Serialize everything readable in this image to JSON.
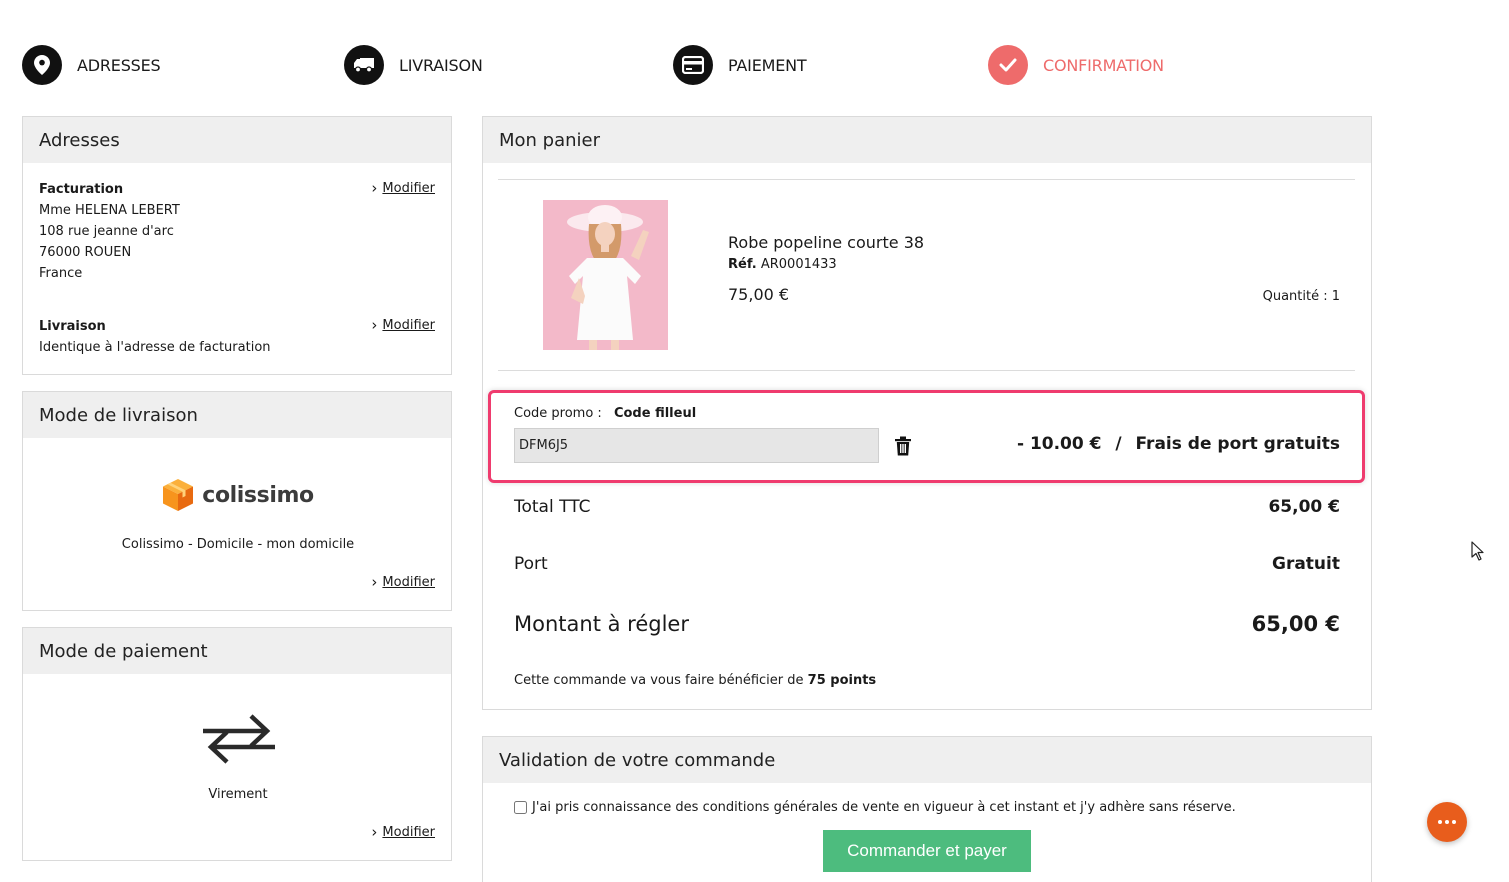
{
  "colors": {
    "accent": "#ee6b6b",
    "promo_border": "#ef3b6e",
    "order_button": "#4dbc7e",
    "chat_button": "#e85d1c"
  },
  "steps": [
    {
      "label": "ADRESSES",
      "icon": "map-pin-icon"
    },
    {
      "label": "LIVRAISON",
      "icon": "truck-icon"
    },
    {
      "label": "PAIEMENT",
      "icon": "credit-card-icon"
    },
    {
      "label": "CONFIRMATION",
      "icon": "check-icon",
      "active": true
    }
  ],
  "addresses": {
    "title": "Adresses",
    "billing": {
      "title": "Facturation",
      "name": "Mme HELENA LEBERT",
      "street": "108 rue jeanne d'arc",
      "city": "76000 ROUEN",
      "country": "France"
    },
    "delivery": {
      "title": "Livraison",
      "text": "Identique à l'adresse de facturation"
    },
    "modify_label": "Modifier"
  },
  "shipping": {
    "title": "Mode de livraison",
    "logo_text": "colissimo",
    "method": "Colissimo - Domicile - mon domicile",
    "modify_label": "Modifier"
  },
  "payment": {
    "title": "Mode de paiement",
    "method": "Virement",
    "modify_label": "Modifier"
  },
  "cart": {
    "title": "Mon panier",
    "product": {
      "name": "Robe popeline courte 38",
      "ref_label": "Réf.",
      "ref": "AR0001433",
      "price": "75,00 €",
      "quantity": "Quantité : 1"
    },
    "promo": {
      "label": "Code promo :",
      "type": "Code filleul",
      "code": "DFM6J5",
      "discount": "- 10.00 €",
      "separator": "/",
      "benefit": "Frais de port gratuits"
    },
    "total_label": "Total TTC",
    "total_value": "65,00 €",
    "port_label": "Port",
    "port_value": "Gratuit",
    "amount_label": "Montant à régler",
    "amount_value": "65,00 €",
    "points_text": "Cette commande va vous faire bénéficier de",
    "points_value": "75 points"
  },
  "validation": {
    "title": "Validation de votre commande",
    "terms": "J'ai pris connaissance des conditions générales de vente en vigueur à cet instant et j'y adhère sans réserve.",
    "terms_checked": false,
    "button": "Commander et payer"
  }
}
